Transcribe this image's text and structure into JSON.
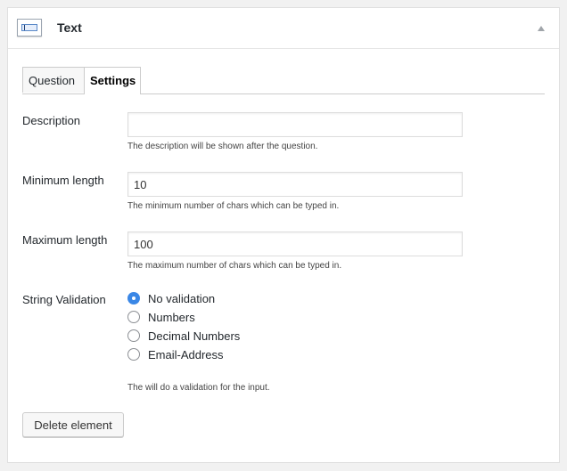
{
  "header": {
    "icon": "text-field-icon",
    "title": "Text"
  },
  "tabs": [
    {
      "label": "Question",
      "active": false
    },
    {
      "label": "Settings",
      "active": true
    }
  ],
  "fields": {
    "description": {
      "label": "Description",
      "value": "",
      "hint": "The description will be shown after the question."
    },
    "min_length": {
      "label": "Minimum length",
      "value": "10",
      "hint": "The minimum number of chars which can be typed in."
    },
    "max_length": {
      "label": "Maximum length",
      "value": "100",
      "hint": "The maximum number of chars which can be typed in."
    },
    "validation": {
      "label": "String Validation",
      "options": [
        {
          "label": "No validation",
          "checked": true
        },
        {
          "label": "Numbers",
          "checked": false
        },
        {
          "label": "Decimal Numbers",
          "checked": false
        },
        {
          "label": "Email-Address",
          "checked": false
        }
      ],
      "hint": "The will do a validation for the input."
    }
  },
  "actions": {
    "delete_label": "Delete element"
  },
  "colors": {
    "radio_accent": "#3a87e6"
  }
}
